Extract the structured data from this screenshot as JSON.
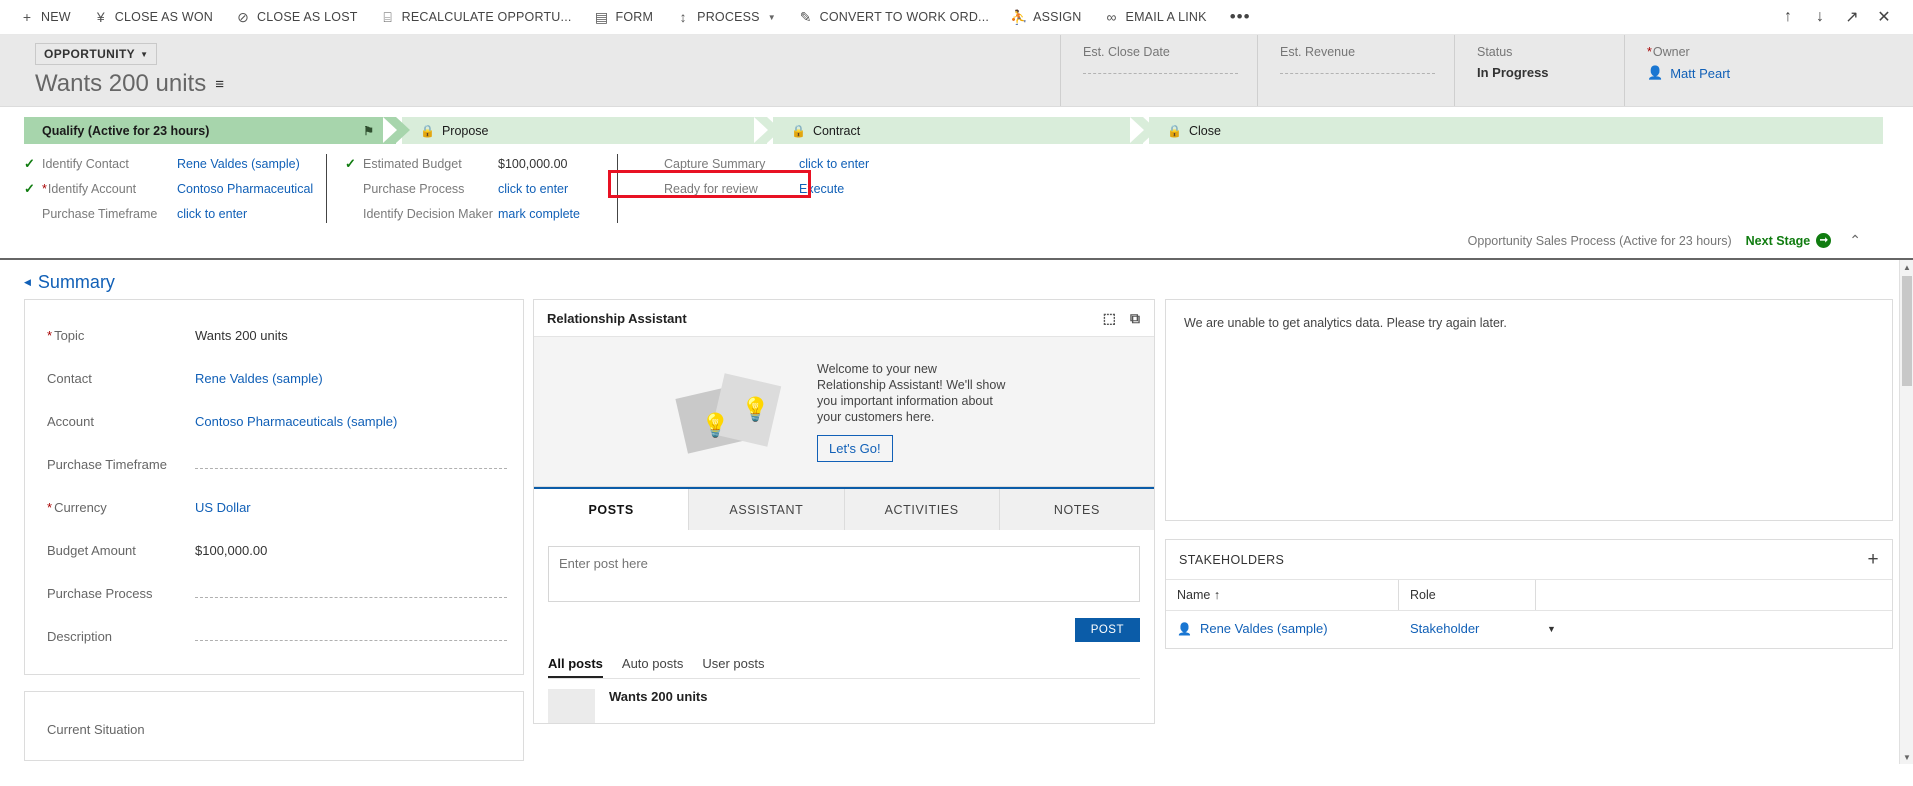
{
  "command_bar": {
    "buttons": [
      {
        "label": "NEW",
        "icon": "plus-icon",
        "glyph": "+"
      },
      {
        "label": "CLOSE AS WON",
        "icon": "trophy-icon",
        "glyph": "¥"
      },
      {
        "label": "CLOSE AS LOST",
        "icon": "no-entry-icon",
        "glyph": "⊘"
      },
      {
        "label": "RECALCULATE OPPORTU...",
        "icon": "calculator-icon",
        "glyph": "⌸"
      },
      {
        "label": "FORM",
        "icon": "form-icon",
        "glyph": "▤"
      },
      {
        "label": "PROCESS",
        "icon": "process-icon",
        "glyph": "↕",
        "has_caret": true
      },
      {
        "label": "CONVERT TO WORK ORD...",
        "icon": "convert-icon",
        "glyph": "✎"
      },
      {
        "label": "ASSIGN",
        "icon": "assign-users-icon",
        "glyph": "⛹"
      },
      {
        "label": "EMAIL A LINK",
        "icon": "link-icon",
        "glyph": "∞"
      }
    ],
    "overflow_label": "•••",
    "right_icons": [
      {
        "name": "previous-record-icon",
        "glyph": "↑"
      },
      {
        "name": "next-record-icon",
        "glyph": "↓"
      },
      {
        "name": "popout-icon",
        "glyph": "↗"
      },
      {
        "name": "close-icon",
        "glyph": "✕"
      }
    ]
  },
  "header": {
    "entity_type": "OPPORTUNITY",
    "record_title": "Wants 200 units",
    "fields": [
      {
        "label": "Est. Close Date",
        "value": "",
        "empty": true,
        "required": false
      },
      {
        "label": "Est. Revenue",
        "value": "",
        "empty": true,
        "required": false
      },
      {
        "label": "Status",
        "value": "In Progress",
        "empty": false,
        "required": false
      },
      {
        "label": "Owner",
        "value": "Matt Peart",
        "empty": false,
        "required": true,
        "is_link": true
      }
    ]
  },
  "process_flow": {
    "stages": [
      {
        "name": "Qualify (Active for 23 hours)",
        "state": "active",
        "locked": false
      },
      {
        "name": "Propose",
        "state": "locked",
        "locked": true
      },
      {
        "name": "Contract",
        "state": "locked",
        "locked": true
      },
      {
        "name": "Close",
        "state": "locked",
        "locked": true
      }
    ],
    "columns": [
      {
        "rows": [
          {
            "checked": true,
            "label": "Identify Contact",
            "required": false,
            "value": "Rene Valdes (sample)",
            "value_type": "link"
          },
          {
            "checked": true,
            "label": "Identify Account",
            "required": true,
            "value": "Contoso Pharmaceutical",
            "value_type": "link"
          },
          {
            "checked": false,
            "label": "Purchase Timeframe",
            "required": false,
            "value": "click to enter",
            "value_type": "link"
          }
        ]
      },
      {
        "rows": [
          {
            "checked": true,
            "label": "Estimated Budget",
            "required": false,
            "value": "$100,000.00",
            "value_type": "plain"
          },
          {
            "checked": false,
            "label": "Purchase Process",
            "required": false,
            "value": "click to enter",
            "value_type": "link"
          },
          {
            "checked": false,
            "label": "Identify Decision Maker",
            "required": false,
            "value": "mark complete",
            "value_type": "link"
          }
        ]
      },
      {
        "rows": [
          {
            "checked": false,
            "label": "Capture Summary",
            "required": false,
            "value": "click to enter",
            "value_type": "link"
          },
          {
            "checked": false,
            "label": "Ready for review",
            "required": false,
            "value": "Execute",
            "value_type": "link"
          }
        ]
      }
    ],
    "highlight_color": "#e81123",
    "footer": {
      "process_name": "Opportunity Sales Process (Active for 23 hours)",
      "next_stage_label": "Next Stage",
      "collapse_glyph": "⌃"
    }
  },
  "summary": {
    "section_title": "Summary",
    "fields": [
      {
        "label": "Topic",
        "required": true,
        "value": "Wants 200 units",
        "type": "text",
        "empty": false
      },
      {
        "label": "Contact",
        "required": false,
        "value": "Rene Valdes (sample)",
        "type": "link",
        "empty": false
      },
      {
        "label": "Account",
        "required": false,
        "value": "Contoso Pharmaceuticals (sample)",
        "type": "link",
        "empty": false
      },
      {
        "label": "Purchase Timeframe",
        "required": false,
        "value": "",
        "type": "text",
        "empty": true
      },
      {
        "label": "Currency",
        "required": true,
        "value": "US Dollar",
        "type": "link",
        "empty": false
      },
      {
        "label": "Budget Amount",
        "required": false,
        "value": "$100,000.00",
        "type": "text",
        "empty": false
      },
      {
        "label": "Purchase Process",
        "required": false,
        "value": "",
        "type": "text",
        "empty": true
      },
      {
        "label": "Description",
        "required": false,
        "value": "",
        "type": "text",
        "empty": true
      }
    ],
    "second_card": {
      "label": "Current Situation",
      "value": "",
      "empty": true
    }
  },
  "relationship_assistant": {
    "title": "Relationship Assistant",
    "header_icons": [
      {
        "name": "comment-icon",
        "glyph": "⬚"
      },
      {
        "name": "refresh-card-icon",
        "glyph": "⧉"
      }
    ],
    "welcome_text": "Welcome to your new Relationship Assistant! We'll show you important information about your customers here.",
    "cta_label": "Let's Go!"
  },
  "social_pane": {
    "tabs": [
      {
        "label": "POSTS",
        "active": true
      },
      {
        "label": "ASSISTANT",
        "active": false
      },
      {
        "label": "ACTIVITIES",
        "active": false
      },
      {
        "label": "NOTES",
        "active": false
      }
    ],
    "post_placeholder": "Enter post here",
    "post_button": "POST",
    "filters": [
      {
        "label": "All posts",
        "active": true
      },
      {
        "label": "Auto posts",
        "active": false
      },
      {
        "label": "User posts",
        "active": false
      }
    ],
    "posts": [
      {
        "title": "Wants 200 units"
      }
    ]
  },
  "analytics": {
    "message": "We are unable to get analytics data. Please try again later."
  },
  "stakeholders": {
    "title": "STAKEHOLDERS",
    "add_glyph": "+",
    "columns": [
      "Name ↑",
      "Role",
      ""
    ],
    "rows": [
      {
        "name": "Rene Valdes (sample)",
        "role": "Stakeholder"
      }
    ]
  },
  "colors": {
    "accent_blue": "#1160b7",
    "stage_active_green": "#a7d5ac",
    "stage_locked_green": "#d9edda",
    "next_stage_green": "#107c10",
    "required_red": "#a80000",
    "highlight_red": "#e81123",
    "post_button_blue": "#0b5ca8"
  }
}
